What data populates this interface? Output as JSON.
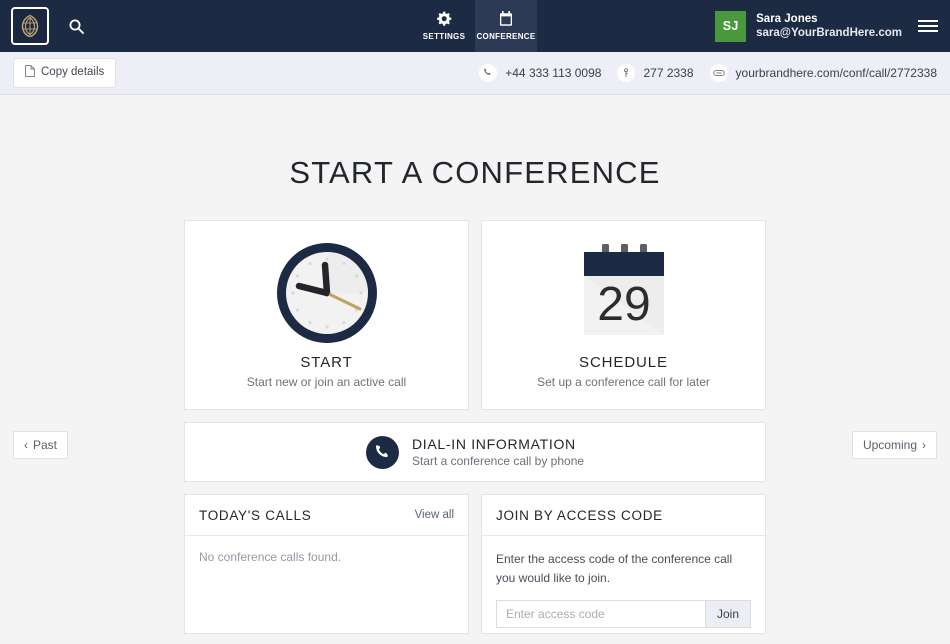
{
  "topnav": {
    "logo_name": "brand-logo",
    "search_icon": "search-icon",
    "tabs": [
      {
        "label": "SETTINGS",
        "icon": "gear-icon",
        "active": false
      },
      {
        "label": "CONFERENCE",
        "icon": "calendar-icon",
        "active": true
      }
    ],
    "user": {
      "initials": "SJ",
      "name": "Sara Jones",
      "email": "sara@YourBrandHere.com",
      "avatar_color": "#4a9a3d"
    },
    "menu_icon": "hamburger-icon",
    "background_color": "#1d2a44"
  },
  "subnav": {
    "copy_label": "Copy details",
    "copy_icon": "copy-document-icon",
    "info": [
      {
        "icon": "phone-icon",
        "text": "+44 333 113 0098"
      },
      {
        "icon": "key-pin-icon",
        "text": "277 2338"
      },
      {
        "icon": "link-icon",
        "text": "yourbrandhere.com/conf/call/2772338"
      }
    ],
    "background_color": "#edeef6"
  },
  "main": {
    "page_title": "START A CONFERENCE",
    "cards": [
      {
        "id": "start",
        "icon": "clock-icon",
        "title": "START",
        "subtitle": "Start new or join an active call"
      },
      {
        "id": "schedule",
        "icon": "calendar-icon",
        "title": "SCHEDULE",
        "subtitle": "Set up a conference call for later",
        "calendar_day": "29"
      }
    ],
    "dialin": {
      "icon": "phone-icon",
      "title": "DIAL-IN INFORMATION",
      "subtitle": "Start a conference call by phone"
    },
    "todays_calls": {
      "title": "TODAY'S CALLS",
      "link_label": "View all",
      "empty_text": "No conference calls found."
    },
    "join_by_code": {
      "title": "JOIN BY ACCESS CODE",
      "description": "Enter the access code of the conference call you would like to join.",
      "input_placeholder": "Enter access code",
      "input_value": "",
      "button_label": "Join"
    },
    "past_button": {
      "label": "Past",
      "icon": "chevron-left-icon"
    },
    "upcoming_button": {
      "label": "Upcoming",
      "icon": "chevron-right-icon"
    },
    "background_color": "#f4f4f4",
    "accent_navy": "#1d2a44"
  }
}
